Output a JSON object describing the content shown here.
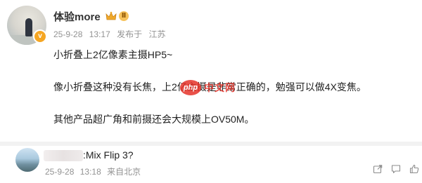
{
  "post": {
    "username": "体验more",
    "level_badge": "Ⅱ",
    "date": "25-9-28",
    "time": "13:17",
    "location_prefix": "发布于",
    "location": "江苏",
    "lines": [
      "小折叠上2亿像素主摄HP5~",
      "像小折叠这种没有长焦，上2亿主摄是非常正确的，勉强可以做4X变焦。",
      "其他产品超广角和前摄还会大规模上OV50M。"
    ]
  },
  "watermark": {
    "logo_text": "php",
    "text": "中文网"
  },
  "comment": {
    "text": ":Mix Flip 3?",
    "date": "25-9-28",
    "time": "13:18",
    "source": "来自北京"
  },
  "icons": {
    "verified": "verified-badge-icon",
    "crown": "crown-icon",
    "share": "share-icon",
    "comment": "comment-icon",
    "like": "like-icon"
  },
  "colors": {
    "accent_gold": "#f5a623",
    "meta_gray": "#939393",
    "watermark_red": "#e6332a"
  }
}
